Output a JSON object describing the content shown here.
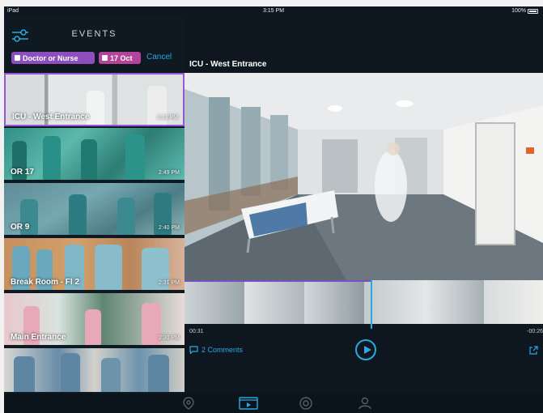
{
  "status": {
    "device": "iPad",
    "time": "3:15 PM",
    "battery": "100%"
  },
  "sidebar": {
    "title": "EVENTS",
    "filters": {
      "tag": "Doctor or Nurse",
      "date": "17 Oct"
    },
    "cancel_label": "Cancel",
    "events": [
      {
        "label": "ICU - West Entrance",
        "time": "2:13 PM",
        "selected": true
      },
      {
        "label": "OR 17",
        "time": "2:49 PM",
        "selected": false
      },
      {
        "label": "OR 9",
        "time": "2:40 PM",
        "selected": false
      },
      {
        "label": "Break Room - Fl 2",
        "time": "2:31 PM",
        "selected": false
      },
      {
        "label": "Main Entrance",
        "time": "2:30 PM",
        "selected": false
      },
      {
        "label": "",
        "time": "",
        "selected": false
      }
    ]
  },
  "player": {
    "camera_title": "ICU - West Entrance",
    "time_elapsed": "00:31",
    "time_remaining": "-00:26",
    "comments_label": "2 Comments",
    "progress": 0.52
  },
  "tabs": [
    {
      "name": "tab-explore",
      "icon": "map-pin-icon"
    },
    {
      "name": "tab-events",
      "icon": "video-icon"
    },
    {
      "name": "tab-camera",
      "icon": "camera-lens-icon"
    },
    {
      "name": "tab-profile",
      "icon": "person-icon"
    }
  ],
  "colors": {
    "accent": "#2aa9e0",
    "tag_chip": "#8c4fbd",
    "date_chip": "#b4439c",
    "selection": "#9a55d6",
    "background": "#0e1720"
  }
}
